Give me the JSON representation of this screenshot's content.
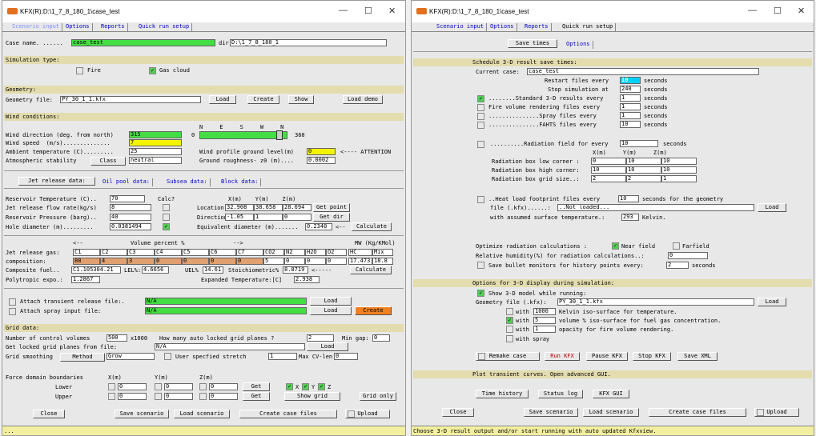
{
  "left": {
    "title": "KFX(R):D:\\1_7_8_180_1\\case_test",
    "tabs": [
      "Scenario input",
      "Options",
      "Reports",
      "Quick run setup"
    ],
    "case_label": "Case name. ......",
    "case_value": "case_test",
    "dir_label": "dir:",
    "dir_value": "D:\\1_7_8_180_1",
    "sim_type": "Simulation type:",
    "fire": "Fire",
    "gas": "Gas cloud",
    "geometry": "Geometry:",
    "geofile_label": "Geometry file:",
    "geofile": "PY_30_1_1.kfx",
    "load": "Load",
    "create": "Create",
    "show": "Show",
    "load_demo": "Load demo",
    "wind": "Wind conditions:",
    "wdir_label": "Wind direction (deg. from north)",
    "wdir": "315",
    "compass": "N     E     S     W     N",
    "wmin": "0",
    "wmax": "360",
    "wind_dir_fraction": 0.875,
    "wspeed_label": "Wind speed  (m/s)..............",
    "wspeed": "7",
    "amb_label": "Ambient temperature (C).........",
    "amb": "25",
    "stab_label": "Atmospheric stability",
    "stab_btn": "Class",
    "stab": "neutral",
    "wpgl_label": "Wind profile ground level(m)",
    "wpgl": "0",
    "attention": "<---- ATTENTION",
    "rough_label": "Ground roughness- z0 (m)....",
    "rough": "0.0002",
    "subtabs": [
      "Jet release data:",
      "Oil pool data:",
      "Subsea data:",
      "Block data:"
    ],
    "rtemp_label": "Reservoir Temperature (C)..",
    "rtemp": "70",
    "calc": "Calc?",
    "xyz": "X(m)    Y(m)    Z(m)",
    "jrate_label": "Jet release flow rate(kg/s)",
    "jrate": "8",
    "loc_label": "Location:",
    "loc_x": "32.908",
    "loc_y": "38.658",
    "loc_z": "28.694",
    "get_point": "Get point",
    "rpress_label": "Reservoir Pressure (barg)..",
    "rpress": "40",
    "dir2_label": "Direction:",
    "dir_x": "-1.05",
    "dir_y": "1",
    "dir_z": "0",
    "get_dir": "Get dir",
    "hole_label": "Hole diameter (m).........",
    "hole": "0.0381494",
    "eqd_label": "Equivalent diameter (m).......",
    "eqd": "0.2340",
    "arrow": "<--",
    "calculate": "Calculate",
    "vp_left": "<--",
    "vp": "Volume percent %",
    "vp_right": "-->",
    "mw": "MW (Kg/KMol)",
    "gas_label": "Jet release gas:",
    "gases": [
      "C1",
      "C2",
      "C3",
      "C4",
      "C5",
      "C6",
      "C7",
      "CO2",
      "N2",
      "H2O",
      "O2",
      "HC",
      "Mix"
    ],
    "comp_label": "composition:",
    "comps": [
      "88",
      "4",
      "3",
      "0",
      "0",
      "0",
      "0",
      "5",
      "0",
      "0",
      "0",
      "17.473",
      "18.8"
    ],
    "cfuel_label": "Composite fuel..",
    "cfuel": "C1.105304.21",
    "lel_label": "LEL%:",
    "lel": "4.6656",
    "uel_label": "UEL%",
    "uel": "14.61",
    "stoich_label": "Stoichiometric%",
    "stoich": "8.8719",
    "arrow2": "<-----",
    "calculate2": "Calculate",
    "poly_label": "Polytropic expo.:",
    "poly": "1.2867",
    "exp_label": "Expanded Temperature:[C]",
    "exp": "2.938",
    "att1": "Attach transient release file:.",
    "att1_val": "N/A",
    "att2": "Attach spray input file:",
    "att2_val": "N/A",
    "create2": "Create",
    "grid": "Grid data:",
    "ncv_label": "Number of control volumes",
    "ncv": "500",
    "x1000": "x1000",
    "alg_label": "How many auto locked grid planes ?",
    "alg": "2",
    "mingap_label": "Min gap:",
    "mingap": "0",
    "lockf_label": "Get locked grid planes from file:",
    "lockf": "N/A",
    "smooth_label": "Grid smoothing",
    "method": "Method",
    "grow": "Grow",
    "user_stretch": "User specfied stretch",
    "stretch": "1",
    "maxcv_label": "Max CV-len",
    "maxcv": "0",
    "force": "Force domain boundaries",
    "fx": "X(m)",
    "fy": "Y(m)",
    "fz": "Z(m)",
    "lower": "Lower",
    "upper": "Upper",
    "zero": "0",
    "get": "Get",
    "x": "X",
    "y": "Y",
    "z": "Z",
    "show_grid": "Show grid",
    "grid_only": "Grid only",
    "close": "Close",
    "save_scen": "Save scenario",
    "load_scen": "Load scenario",
    "create_case": "Create case files",
    "upload": "Upload",
    "status": "..."
  },
  "right": {
    "title": "KFX(R):D:\\1_7_8_180_1\\case_test",
    "tabs": [
      "Scenario input",
      "Options",
      "Reports",
      "Quick run setup"
    ],
    "subtabs": [
      "Save times",
      "Options"
    ],
    "sched": "Schedule 3-D result save times:",
    "cur_label": "Current case:",
    "cur": "case_test",
    "restart_label": "Restart files every",
    "restart": "10",
    "seconds": "seconds",
    "stop_label": "Stop simulation at",
    "stop": "240",
    "std_label": "........Standard 3-D results every",
    "std": "1",
    "fire_label": "Fire volume rendering files every",
    "fire": "1",
    "spray_label": "...............Spray files every",
    "spray": "1",
    "fahts_label": "...............FAHTS files every",
    "fahts": "10",
    "rad_label": "..........Radiation field for every",
    "rad": "10",
    "rxyz": "X(m)     Y(m)     Z(m)",
    "rlow_label": "Radiation box low corner :",
    "rlow": [
      "0",
      "10",
      "10"
    ],
    "rhigh_label": "Radiation box high corner:",
    "rhigh": [
      "10",
      "10",
      "10"
    ],
    "rgrid_label": "Radiation box grid size..:",
    "rgrid": [
      "2",
      "2",
      "1"
    ],
    "heat_label": "..Heat load footprint files every",
    "heat": "10",
    "heat_tail": "seconds for the geometry",
    "hfile_label": "file (.kfx)......:",
    "hfile": "..Not loaded...",
    "load": "Load",
    "surf_label": "with assumed surface temperature.:",
    "surf": "293",
    "kelvin": "Kelvin.",
    "opt_rad": "Optimize radiation calculations :",
    "near": "Near field",
    "far": "Farfield",
    "hum_label": "Relative humidity(%) for radiation calculations..:",
    "hum": "0",
    "bullet_label": "Save bullet monitors for history points every:",
    "bullet": "2",
    "disp": "Options for 3-D display during simulation:",
    "show3d": "Show 3-D model while running:",
    "dgeo_label": "Geometry file (.kfx):",
    "dgeo": "PY_30_1_1.kfx",
    "w1": "with",
    "w1v": "1000",
    "w1t": "Kelvin iso-surface for temperature.",
    "w2v": "5",
    "w2t": "volume % iso-surface for fuel gas concentration.",
    "w3v": "1",
    "w3t": "opacity for fire volume rendering.",
    "w4t": "with spray",
    "remake": "Remake case",
    "run": "Run KFX",
    "pause": "Pause KFX",
    "stopk": "Stop KFX",
    "savexml": "Save XML",
    "plot": "Plot transient curves. Open advanced GUI.",
    "timehist": "Time history",
    "statuslog": "Status log",
    "kfxgui": "KFX GUI",
    "close": "Close",
    "save_scen": "Save scenario",
    "load_scen": "Load scenario",
    "create_case": "Create case files",
    "upload": "Upload",
    "status": "Choose 3-D result output and/or start running with auto updated Kfxview."
  },
  "colors": {
    "green": "#44dd44",
    "yellow": "#f4f400",
    "orange": "#e0a070",
    "section": "#e3dcae",
    "blue_field": "#00d0ff"
  }
}
